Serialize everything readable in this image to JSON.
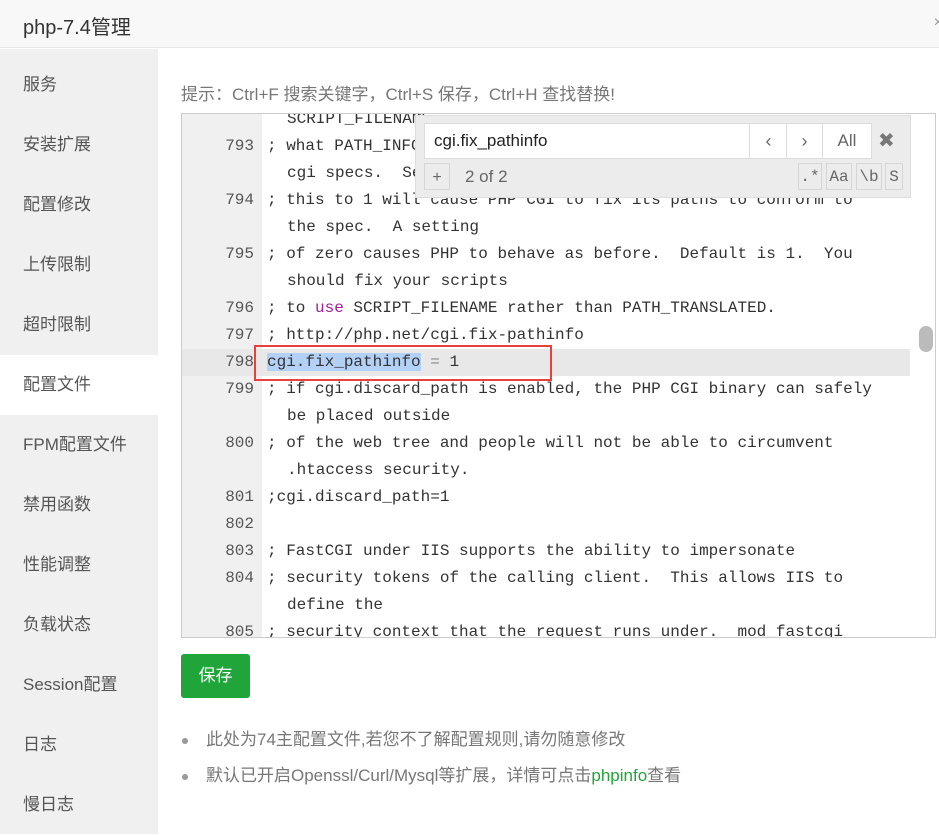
{
  "window": {
    "title": "php-7.4管理",
    "close": "×"
  },
  "sidebar": {
    "items": [
      "服务",
      "安装扩展",
      "配置修改",
      "上传限制",
      "超时限制",
      "配置文件",
      "FPM配置文件",
      "禁用函数",
      "性能调整",
      "负载状态",
      "Session配置",
      "日志",
      "慢日志"
    ],
    "active": 5
  },
  "hint": "提示：Ctrl+F 搜索关键字，Ctrl+S 保存，Ctrl+H 查找替换!",
  "editor": {
    "rows": [
      {
        "n": "",
        "c": true,
        "p": [
          [
            "",
            "SCRIPT_FILENAME"
          ]
        ]
      },
      {
        "n": "793",
        "p": [
          [
            "",
            "; what PATH_INFO is. For more information on PATH_INFO, see the"
          ]
        ]
      },
      {
        "n": "",
        "c": true,
        "p": [
          [
            "",
            "cgi specs.  Setting"
          ]
        ]
      },
      {
        "n": "794",
        "p": [
          [
            "",
            "; this to 1 will cause PHP CGI to fix its paths to conform to"
          ]
        ]
      },
      {
        "n": "",
        "c": true,
        "p": [
          [
            "",
            "the spec.  A setting"
          ]
        ]
      },
      {
        "n": "795",
        "p": [
          [
            "",
            "; of zero causes PHP to behave as before.  Default is 1.  You"
          ]
        ]
      },
      {
        "n": "",
        "c": true,
        "p": [
          [
            "",
            "should fix your scripts"
          ]
        ]
      },
      {
        "n": "796",
        "p": [
          [
            "",
            "; to "
          ],
          [
            "kw",
            "use"
          ],
          [
            "",
            " SCRIPT_FILENAME rather than PATH_TRANSLATED."
          ]
        ]
      },
      {
        "n": "797",
        "p": [
          [
            "",
            "; http://php.net/cgi.fix-pathinfo"
          ]
        ]
      },
      {
        "n": "798",
        "cur": true,
        "p": [
          [
            "sel",
            "cgi.fix_pathinfo"
          ],
          [
            "",
            " "
          ],
          [
            "op",
            "="
          ],
          [
            "",
            " 1"
          ]
        ]
      },
      {
        "n": "799",
        "p": [
          [
            "",
            "; if cgi.discard_path is enabled, the PHP CGI binary can safely"
          ]
        ]
      },
      {
        "n": "",
        "c": true,
        "p": [
          [
            "",
            "be placed outside"
          ]
        ]
      },
      {
        "n": "800",
        "p": [
          [
            "",
            "; of the web tree and people will not be able to circumvent"
          ]
        ]
      },
      {
        "n": "",
        "c": true,
        "p": [
          [
            "",
            ".htaccess security."
          ]
        ]
      },
      {
        "n": "801",
        "p": [
          [
            "",
            ";cgi.discard_path=1"
          ]
        ]
      },
      {
        "n": "802",
        "p": [
          [
            "",
            ""
          ]
        ]
      },
      {
        "n": "803",
        "p": [
          [
            "",
            "; FastCGI under IIS supports the ability to impersonate"
          ]
        ]
      },
      {
        "n": "804",
        "p": [
          [
            "",
            "; security tokens of the calling client.  This allows IIS to"
          ]
        ]
      },
      {
        "n": "",
        "c": true,
        "p": [
          [
            "",
            "define the"
          ]
        ]
      },
      {
        "n": "805",
        "p": [
          [
            "",
            "; security context that the request runs under.  mod_fastcgi"
          ]
        ]
      }
    ]
  },
  "search": {
    "query": "cgi.fix_pathinfo",
    "prev": "‹",
    "next": "›",
    "all": "All",
    "close": "✖",
    "add": "+",
    "count": "2 of 2",
    "regex": ".*",
    "case": "Aa",
    "word": "\\b",
    "selection": "S"
  },
  "save_label": "保存",
  "notes": {
    "n1": "此处为74主配置文件,若您不了解配置规则,请勿随意修改",
    "n2_pre": "默认已开启Openssl/Curl/Mysql等扩展，详情可点击",
    "n2_link": "phpinfo",
    "n2_post": "查看"
  },
  "colors": {
    "accent": "#20a53a",
    "highlight_box": "#e8403a",
    "keyword": "#a020a0"
  }
}
